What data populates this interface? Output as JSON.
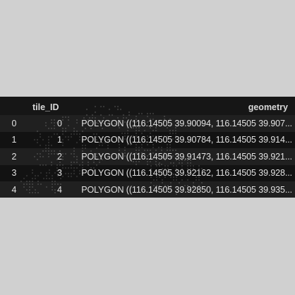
{
  "table": {
    "columns": [
      "",
      "tile_ID",
      "geometry"
    ],
    "rows": [
      {
        "index": "0",
        "tile_ID": "0",
        "geometry": "POLYGON ((116.14505 39.90094, 116.14505 39.907..."
      },
      {
        "index": "1",
        "tile_ID": "1",
        "geometry": "POLYGON ((116.14505 39.90784, 116.14505 39.914..."
      },
      {
        "index": "2",
        "tile_ID": "2",
        "geometry": "POLYGON ((116.14505 39.91473, 116.14505 39.921..."
      },
      {
        "index": "3",
        "tile_ID": "3",
        "geometry": "POLYGON ((116.14505 39.92162, 116.14505 39.928..."
      },
      {
        "index": "4",
        "tile_ID": "4",
        "geometry": "POLYGON ((116.14505 39.92850, 116.14505 39.935..."
      }
    ]
  }
}
